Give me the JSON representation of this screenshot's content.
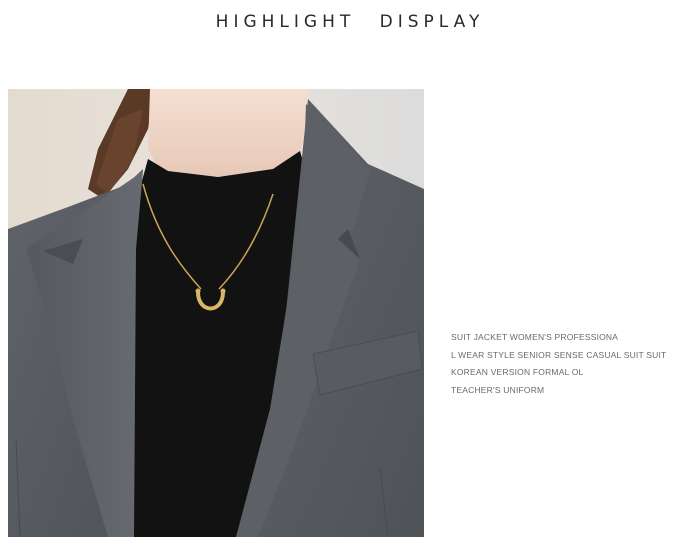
{
  "heading": "HIGHLIGHT DISPLAY",
  "photo": {
    "subject": "model-wearing-gray-blazer-black-turtleneck-horseshoe-necklace"
  },
  "description_lines": [
    "SUIT JACKET WOMEN'S PROFESSIONA",
    "L WEAR STYLE SENIOR SENSE CASUAL SUIT SUIT",
    "KOREAN VERSION FORMAL OL",
    "TEACHER'S UNIFORM"
  ],
  "colors": {
    "blazer": "#5b5f64",
    "turtleneck": "#111111",
    "skin": "#efd7c8",
    "background": "#ffffff",
    "necklace": "#c9a655"
  }
}
